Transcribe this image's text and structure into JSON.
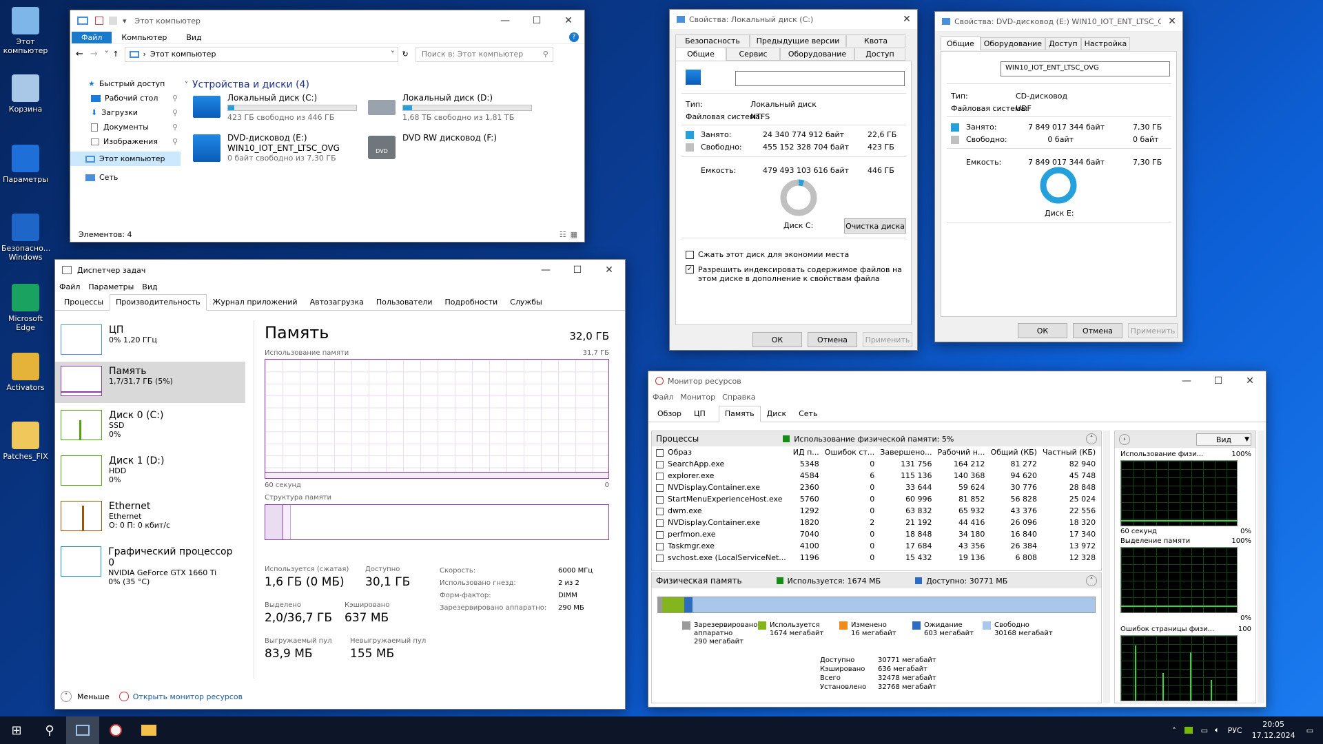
{
  "desktop": {
    "icons": [
      {
        "label": "Этот компьютер",
        "color": "#7fb6ea"
      },
      {
        "label": "Корзина",
        "color": "#a9c8e8"
      },
      {
        "label": "Параметры",
        "color": "#1f6fd8"
      },
      {
        "label": "Безопасно... Windows",
        "color": "#1e67c8"
      },
      {
        "label": "Microsoft Edge",
        "color": "#1aa260"
      },
      {
        "label": "Activators",
        "color": "#e6b33a"
      },
      {
        "label": "Patches_FIX",
        "color": "#f0c75a"
      }
    ]
  },
  "explorer": {
    "title": "Этот компьютер",
    "ribbon_tabs": [
      "Файл",
      "Компьютер",
      "Вид"
    ],
    "address": "Этот компьютер",
    "search_placeholder": "Поиск в: Этот компьютер",
    "nav": [
      {
        "label": "Быстрый доступ"
      },
      {
        "label": "Рабочий стол"
      },
      {
        "label": "Загрузки"
      },
      {
        "label": "Документы"
      },
      {
        "label": "Изображения"
      },
      {
        "label": "Этот компьютер"
      },
      {
        "label": "Сеть"
      }
    ],
    "group_header": "Устройства и диски (4)",
    "drives": [
      {
        "name": "Локальный диск (C:)",
        "free": "423 ГБ свободно из 446 ГБ",
        "used_pct": 5
      },
      {
        "name": "Локальный диск (D:)",
        "free": "1,68 ТБ свободно из 1,81 ТБ",
        "used_pct": 7
      },
      {
        "name": "DVD-дисковод (E:)",
        "sub": "WIN10_IOT_ENT_LTSC_OVG",
        "free": "0 байт свободно из 7,30 ГБ"
      },
      {
        "name": "DVD RW дисковод (F:)",
        "badge": "DVD"
      }
    ],
    "status": "Элементов: 4"
  },
  "taskmgr": {
    "title": "Диспетчер задач",
    "menu": [
      "Файл",
      "Параметры",
      "Вид"
    ],
    "tabs": [
      "Процессы",
      "Производительность",
      "Журнал приложений",
      "Автозагрузка",
      "Пользователи",
      "Подробности",
      "Службы"
    ],
    "side": [
      {
        "title": "ЦП",
        "l1": "0% 1,20 ГГц",
        "l2": ""
      },
      {
        "title": "Память",
        "l1": "1,7/31,7 ГБ (5%)",
        "l2": ""
      },
      {
        "title": "Диск 0 (C:)",
        "l1": "SSD",
        "l2": "0%"
      },
      {
        "title": "Диск 1 (D:)",
        "l1": "HDD",
        "l2": "0%"
      },
      {
        "title": "Ethernet",
        "l1": "Ethernet",
        "l2": "О: 0 П: 0 кбит/с"
      },
      {
        "title": "Графический процессор 0",
        "l1": "NVIDIA GeForce GTX 1660 Ti",
        "l2": "0% (35 °C)"
      }
    ],
    "heading": "Память",
    "total": "32,0 ГБ",
    "usage_label": "Использование памяти",
    "usage_max": "31,7 ГБ",
    "axis_left": "60 секунд",
    "axis_right": "0",
    "struct_label": "Структура памяти",
    "stats": [
      {
        "label": "Используется (сжатая)",
        "value": "1,6 ГБ (0 МБ)"
      },
      {
        "label": "Доступно",
        "value": "30,1 ГБ"
      },
      {
        "label": "Выделено",
        "value": "2,0/36,7 ГБ"
      },
      {
        "label": "Кэшировано",
        "value": "637 МБ"
      },
      {
        "label": "Выгружаемый пул",
        "value": "83,9 МБ"
      },
      {
        "label": "Невыгружаемый пул",
        "value": "155 МБ"
      }
    ],
    "info": [
      {
        "k": "Скорость:",
        "v": "6000 МГц"
      },
      {
        "k": "Использовано гнезд:",
        "v": "2 из 2"
      },
      {
        "k": "Форм-фактор:",
        "v": "DIMM"
      },
      {
        "k": "Зарезервировано аппаратно:",
        "v": "290 МБ"
      }
    ],
    "less": "Меньше",
    "open_monitor": "Открыть монитор ресурсов"
  },
  "propC": {
    "title": "Свойства: Локальный диск (C:)",
    "tabs_top": [
      "Безопасность",
      "Предыдущие версии",
      "Квота"
    ],
    "tabs_bottom": [
      "Общие",
      "Сервис",
      "Оборудование",
      "Доступ"
    ],
    "type_k": "Тип:",
    "type_v": "Локальный диск",
    "fs_k": "Файловая система:",
    "fs_v": "NTFS",
    "used_k": "Занято:",
    "used_b": "24 340 774 912 байт",
    "used_g": "22,6 ГБ",
    "free_k": "Свободно:",
    "free_b": "455 152 328 704 байт",
    "free_g": "423 ГБ",
    "cap_k": "Емкость:",
    "cap_b": "479 493 103 616 байт",
    "cap_g": "446 ГБ",
    "disk_label": "Диск C:",
    "cleanup": "Очистка диска",
    "chk1": "Сжать этот диск для экономии места",
    "chk2": "Разрешить индексировать содержимое файлов на этом диске в дополнение к свойствам файла",
    "ok": "ОК",
    "cancel": "Отмена",
    "apply": "Применить",
    "used_fraction": 0.05
  },
  "propE": {
    "title": "Свойства: DVD-дисковод (E:) WIN10_IOT_ENT_LTSC_O...",
    "tabs": [
      "Общие",
      "Оборудование",
      "Доступ",
      "Настройка"
    ],
    "label_value": "WIN10_IOT_ENT_LTSC_OVG",
    "type_k": "Тип:",
    "type_v": "CD-дисковод",
    "fs_k": "Файловая система:",
    "fs_v": "UDF",
    "used_k": "Занято:",
    "used_b": "7 849 017 344 байт",
    "used_g": "7,30 ГБ",
    "free_k": "Свободно:",
    "free_b": "0 байт",
    "free_g": "0 байт",
    "cap_k": "Емкость:",
    "cap_b": "7 849 017 344 байт",
    "cap_g": "7,30 ГБ",
    "disk_label": "Диск E:",
    "ok": "ОК",
    "cancel": "Отмена",
    "apply": "Применить"
  },
  "resmon": {
    "title": "Монитор ресурсов",
    "menu": [
      "Файл",
      "Монитор",
      "Справка"
    ],
    "tabs": [
      "Обзор",
      "ЦП",
      "Память",
      "Диск",
      "Сеть"
    ],
    "proc_header": "Процессы",
    "proc_status": "Использование физической памяти: 5%",
    "columns": [
      "Образ",
      "ИД п...",
      "Ошибок ст...",
      "Завершено...",
      "Рабочий н...",
      "Общий (КБ)",
      "Частный (КБ)"
    ],
    "rows": [
      [
        "SearchApp.exe",
        "5348",
        "0",
        "131 756",
        "164 212",
        "81 272",
        "82 940"
      ],
      [
        "explorer.exe",
        "4584",
        "6",
        "115 136",
        "140 368",
        "94 620",
        "45 748"
      ],
      [
        "NVDisplay.Container.exe",
        "2360",
        "0",
        "33 644",
        "59 624",
        "30 776",
        "28 848"
      ],
      [
        "StartMenuExperienceHost.exe",
        "5760",
        "0",
        "60 996",
        "81 852",
        "56 828",
        "25 024"
      ],
      [
        "dwm.exe",
        "1292",
        "0",
        "63 832",
        "65 932",
        "43 376",
        "22 556"
      ],
      [
        "NVDisplay.Container.exe",
        "1820",
        "2",
        "21 192",
        "44 416",
        "26 096",
        "18 320"
      ],
      [
        "perfmon.exe",
        "7040",
        "0",
        "18 848",
        "34 180",
        "16 840",
        "17 340"
      ],
      [
        "Taskmgr.exe",
        "4100",
        "0",
        "17 684",
        "43 356",
        "26 384",
        "13 972"
      ],
      [
        "svchost.exe (LocalServiceNet...",
        "1196",
        "0",
        "15 432",
        "19 136",
        "6 808",
        "12 328"
      ]
    ],
    "phys_header": "Физическая память",
    "phys_used": "Используется: 1674 МБ",
    "phys_avail": "Доступно: 30771 МБ",
    "legend": [
      {
        "name": "Зарезервировано аппаратно",
        "val": "290 мегабайт",
        "color": "#9a9a9a"
      },
      {
        "name": "Используется",
        "val": "1674 мегабайт",
        "color": "#84b51d"
      },
      {
        "name": "Изменено",
        "val": "16 мегабайт",
        "color": "#f08c1e"
      },
      {
        "name": "Ожидание",
        "val": "603 мегабайт",
        "color": "#2e6cbf"
      },
      {
        "name": "Свободно",
        "val": "30168 мегабайт",
        "color": "#a8c7ea"
      }
    ],
    "summary": [
      {
        "k": "Доступно",
        "v": "30771 мегабайт"
      },
      {
        "k": "Кэшировано",
        "v": "636 мегабайт"
      },
      {
        "k": "Всего",
        "v": "32478 мегабайт"
      },
      {
        "k": "Установлено",
        "v": "32768 мегабайт"
      }
    ],
    "view_btn": "Вид",
    "graphs": [
      {
        "title": "Использование физи...",
        "pct": "100%",
        "bl": "60 секунд",
        "br": "0%"
      },
      {
        "title": "Выделение памяти",
        "pct": "100%",
        "bl": "",
        "br": "0%"
      },
      {
        "title": "Ошибок страницы физи...",
        "pct": "100",
        "bl": "",
        "br": ""
      }
    ]
  },
  "taskbar": {
    "lang": "РУС",
    "time": "20:05",
    "date": "17.12.2024"
  }
}
